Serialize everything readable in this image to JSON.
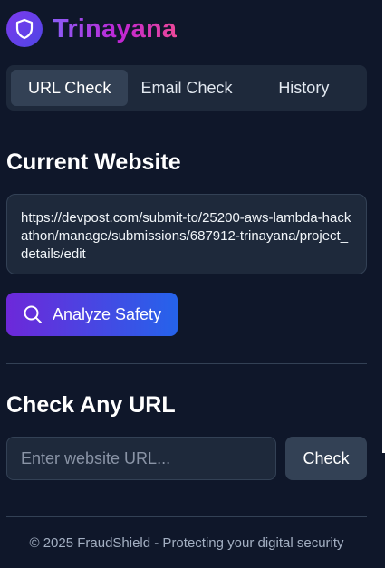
{
  "app": {
    "name": "Trinayana",
    "logo_icon": "shield-icon",
    "brand_colors": [
      "#8b5cf6",
      "#ec4899"
    ]
  },
  "tabs": [
    {
      "label": "URL Check",
      "active": true
    },
    {
      "label": "Email Check",
      "active": false
    },
    {
      "label": "History",
      "active": false
    }
  ],
  "current_website": {
    "title": "Current Website",
    "url": "https://devpost.com/submit-to/25200-aws-lambda-hackathon/manage/submissions/687912-trinayana/project_details/edit",
    "analyze_label": "Analyze Safety",
    "analyze_icon": "search-icon"
  },
  "check_any": {
    "title": "Check Any URL",
    "input_placeholder": "Enter website URL...",
    "input_value": "",
    "check_label": "Check"
  },
  "footer": {
    "text": "© 2025 FraudShield - Protecting your digital security"
  }
}
